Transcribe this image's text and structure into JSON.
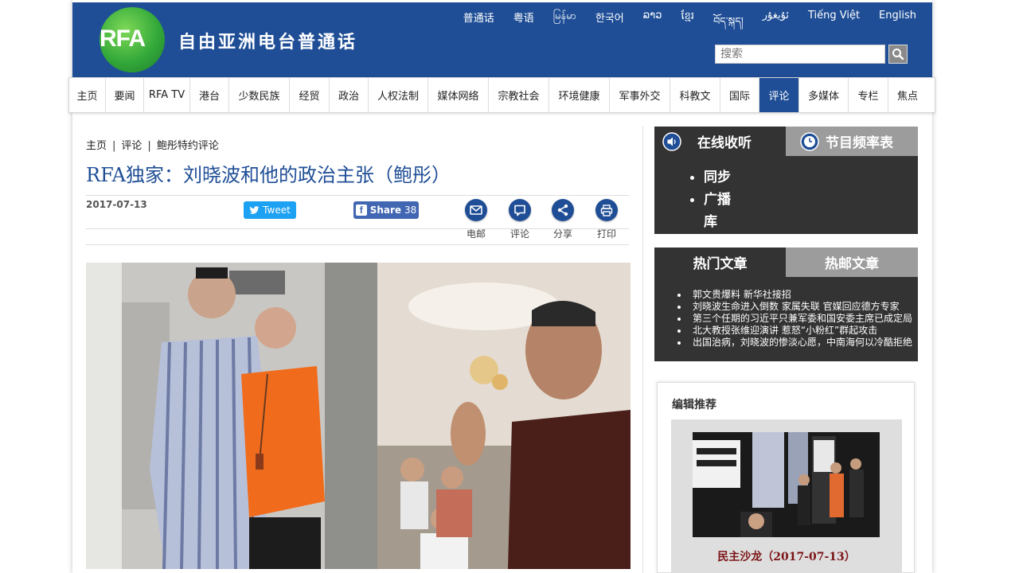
{
  "header": {
    "logo_text": "RFA",
    "site_title": "自由亚洲电台普通话",
    "languages": [
      "普通话",
      "粤语",
      "မြန်မာ",
      "한국어",
      "ລາວ",
      "ខ្មែរ",
      "བོད་སྐད།",
      "ئۇيغۇر",
      "Tiếng Việt",
      "English"
    ],
    "search_placeholder": "搜索"
  },
  "nav": {
    "items": [
      "主页",
      "要闻",
      "RFA TV",
      "港台",
      "少数民族",
      "经贸",
      "政治",
      "人权法制",
      "媒体网络",
      "宗教社会",
      "环境健康",
      "军事外交",
      "科教文",
      "国际",
      "评论",
      "多媒体",
      "专栏",
      "焦点"
    ],
    "active": "评论"
  },
  "article": {
    "breadcrumb": [
      "主页",
      "评论",
      "鲍彤特约评论"
    ],
    "title": "RFA独家：刘晓波和他的政治主张（鲍彤）",
    "date": "2017-07-13",
    "tweet_label": "Tweet",
    "share_label": "Share",
    "share_count": "38",
    "actions": [
      "电邮",
      "评论",
      "分享",
      "打印"
    ]
  },
  "sidebar": {
    "listen_tab": "在线收听",
    "schedule_tab": "节目频率表",
    "listen_items": [
      "同步",
      "广播",
      "库"
    ],
    "hot_tab": "热门文章",
    "email_tab": "热邮文章",
    "hot_items": [
      "郭文贵爆料 新华社接招",
      "刘晓波生命进入倒数 家属失联 官媒回应德方专家",
      "第三个任期的习近平只兼军委和国安委主席已成定局",
      "北大教授张维迎演讲 惹怒“小粉红”群起攻击",
      "出国治病，刘晓波的惨淡心愿，中南海何以冷酷拒绝"
    ],
    "rec_title": "编辑推荐",
    "rec_caption": "民主沙龙（2017-07-13）"
  },
  "colors": {
    "brand_blue": "#1f4e96",
    "sidebar_dark": "#333333",
    "tab_grey": "#9c9c9c",
    "caption_red": "#7b1416"
  }
}
